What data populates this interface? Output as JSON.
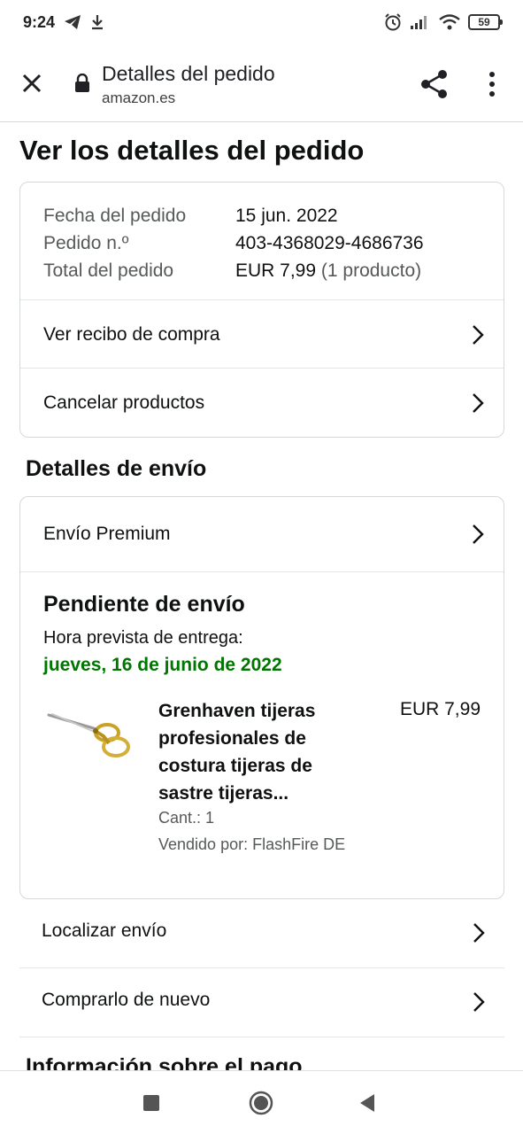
{
  "status_bar": {
    "time": "9:24",
    "battery": "59"
  },
  "browser": {
    "title": "Detalles del pedido",
    "url": "amazon.es"
  },
  "page": {
    "title": "Ver los detalles del pedido"
  },
  "order_summary": {
    "date_label": "Fecha del pedido",
    "date_value": "15 jun. 2022",
    "number_label": "Pedido n.º",
    "number_value": "403-4368029-4686736",
    "total_label": "Total del pedido",
    "total_value": "EUR 7,99",
    "total_count": "(1 producto)",
    "actions": [
      {
        "label": "Ver recibo de compra"
      },
      {
        "label": "Cancelar productos"
      }
    ]
  },
  "shipping": {
    "section_title": "Detalles de envío",
    "method": "Envío Premium",
    "status": "Pendiente de envío",
    "eta_label": "Hora prevista de entrega:",
    "eta_date": "jueves, 16 de junio de 2022",
    "product": {
      "name": "Grenhaven tijeras profesionales de costura tijeras de sastre tijeras...",
      "price": "EUR 7,99",
      "quantity": "Cant.: 1",
      "seller": "Vendido por: FlashFire DE"
    }
  },
  "more_actions": [
    {
      "label": "Localizar envío"
    },
    {
      "label": "Comprarlo de nuevo"
    }
  ],
  "payment": {
    "section_title": "Información sobre el pago"
  },
  "colors": {
    "delivery_green": "#007600",
    "muted_text": "#565959",
    "border": "#d5d9d9"
  }
}
